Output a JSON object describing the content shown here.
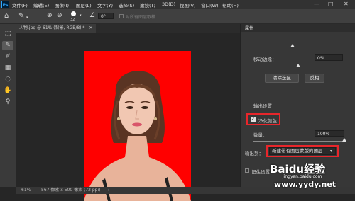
{
  "menubar": {
    "logo": "Ps",
    "items": [
      "文件(F)",
      "编辑(E)",
      "图像(I)",
      "图层(L)",
      "文字(Y)",
      "选择(S)",
      "滤镜(T)",
      "3D(D)",
      "视图(V)",
      "窗口(W)",
      "帮助(H)"
    ],
    "window_controls": [
      "—",
      "□",
      "✕"
    ]
  },
  "options": {
    "size_value": "32",
    "angle_value": "0°",
    "sample_label": "对所有图层取样"
  },
  "document": {
    "tab_label": "人物.jpg @ 61% (背景, RGB/8) *",
    "tab_close": "✕"
  },
  "statusbar": {
    "zoom": "61%",
    "info": "567 像素 x 500 像素 (72 ppi)",
    "arrow": "›"
  },
  "properties": {
    "panel_title": "属性",
    "shift_edge_label": "移动边缘：",
    "shift_edge_value": "0%",
    "clear_selection_label": "清除选区",
    "invert_label": "反相",
    "output_section_label": "输出设置",
    "decontaminate_label": "净化颜色",
    "amount_label": "数量：",
    "amount_value": "100%",
    "output_to_label": "输出到：",
    "output_to_value": "新建带有图层蒙版的图层",
    "remember_label": "记住设置"
  },
  "watermark": {
    "brand": "Baidu经验",
    "url": "jingyan.baidu.com",
    "site": "www.yydy.net"
  },
  "colors": {
    "background_red": "#ff0000",
    "highlight": "#e8262b"
  }
}
